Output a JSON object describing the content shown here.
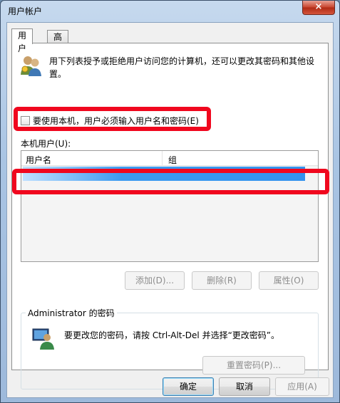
{
  "window": {
    "title": "用户帐户",
    "close_glyph": "×"
  },
  "tabs": [
    {
      "label": "用户"
    },
    {
      "label": "高级"
    }
  ],
  "description": "用下列表授予或拒绝用户访问您的计算机，还可以更改其密码和其他设置。",
  "checkbox": {
    "label": "要使用本机，用户必须输入用户名和密码(E)",
    "checked": false
  },
  "local_users": {
    "label": "本机用户(U):",
    "columns": [
      "用户名",
      "组"
    ]
  },
  "user_buttons": {
    "add": "添加(D)...",
    "remove": "删除(R)",
    "properties": "属性(O)"
  },
  "password_group": {
    "legend": "Administrator 的密码",
    "text": "要更改您的密码，请按 Ctrl-Alt-Del 并选择“更改密码”。",
    "reset_button": "重置密码(P)..."
  },
  "dialog_buttons": {
    "ok": "确定",
    "cancel": "取消",
    "apply": "应用(A)"
  },
  "colors": {
    "highlight": "#f0071e",
    "selection": "#3393ee"
  }
}
